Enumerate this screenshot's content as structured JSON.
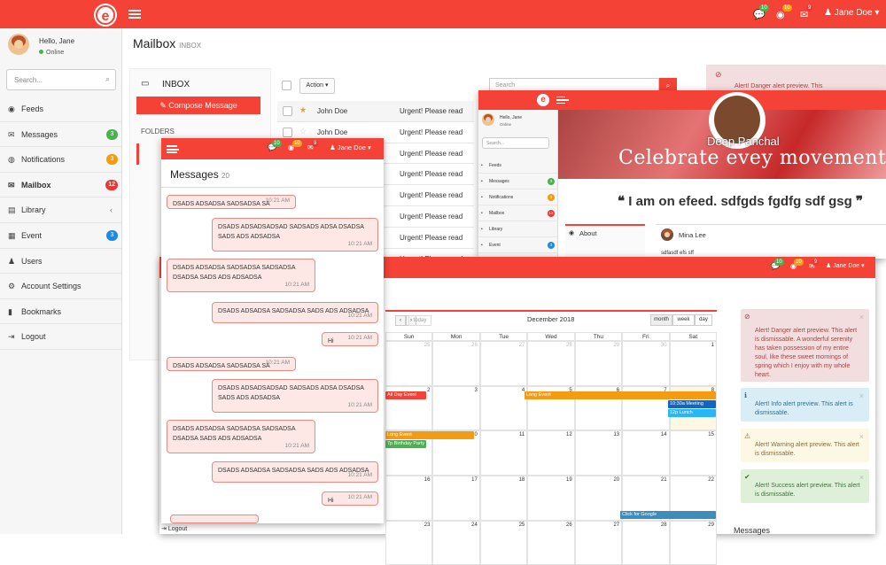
{
  "app": {
    "logo_letter": "e",
    "page_title": "Mailbox",
    "page_subtitle": "INBOX",
    "user_name": "Jane Doe",
    "top_badges": [
      "10",
      "10",
      "9"
    ]
  },
  "sidebar": {
    "greeting": "Hello, Jane",
    "status": "Online",
    "search_placeholder": "Search...",
    "items": [
      {
        "label": "Feeds",
        "icon": "feeds-icon",
        "glyph": "◉",
        "badge": "",
        "badge_color": ""
      },
      {
        "label": "Messages",
        "icon": "messages-icon",
        "glyph": "✉",
        "badge": "3",
        "badge_color": "green"
      },
      {
        "label": "Notifications",
        "icon": "globe-icon",
        "glyph": "◍",
        "badge": "3",
        "badge_color": "orange"
      },
      {
        "label": "Mailbox",
        "icon": "envelope-icon",
        "glyph": "✉",
        "badge": "12",
        "badge_color": "red"
      },
      {
        "label": "Library",
        "icon": "book-icon",
        "glyph": "▤",
        "badge": "",
        "badge_color": ""
      },
      {
        "label": "Event",
        "icon": "calendar-icon",
        "glyph": "▦",
        "badge": "3",
        "badge_color": "blue"
      },
      {
        "label": "Users",
        "icon": "users-icon",
        "glyph": "♟",
        "badge": "",
        "badge_color": ""
      },
      {
        "label": "Account Settings",
        "icon": "gear-icon",
        "glyph": "⚙",
        "badge": "",
        "badge_color": ""
      },
      {
        "label": "Bookmarks",
        "icon": "bookmark-icon",
        "glyph": "▮",
        "badge": "",
        "badge_color": ""
      },
      {
        "label": "Logout",
        "icon": "logout-icon",
        "glyph": "⇥",
        "badge": "",
        "badge_color": ""
      }
    ]
  },
  "mailbox": {
    "inbox_label": "INBOX",
    "compose_label": "Compose Message",
    "folders_label": "FOLDERS",
    "action_label": "Action",
    "search_placeholder": "Search",
    "rows": [
      {
        "from": "John Doe",
        "subject": "Urgent! Please read",
        "starred": true
      },
      {
        "from": "John Doe",
        "subject": "Urgent! Please read",
        "starred": false
      },
      {
        "from": "John Doe",
        "subject": "Urgent! Please read",
        "starred": false
      },
      {
        "from": "John Doe",
        "subject": "Urgent! Please read",
        "starred": false
      },
      {
        "from": "",
        "subject": "Urgent! Please read",
        "starred": false
      },
      {
        "from": "",
        "subject": "Urgent! Please read",
        "starred": false
      },
      {
        "from": "",
        "subject": "Urgent! Please read",
        "starred": false
      },
      {
        "from": "",
        "subject": "Urgent! Please read",
        "starred": false
      }
    ]
  },
  "messages_window": {
    "title": "Messages",
    "count": "20",
    "user": "Jane Doe",
    "badges": [
      "10",
      "10",
      "9"
    ],
    "logout": "Logout",
    "bubbles": [
      {
        "text": "DSADS ADSADSA SADSADSA SA",
        "time": "10:21 AM",
        "side": "left"
      },
      {
        "text": "DSADS ADSADSADSAD SADSADS ADSA DSADSA SADS ADS ADSADSA",
        "time": "10:21 AM",
        "side": "right"
      },
      {
        "text": "DSADS ADSADSA SADSADSA SADSADSA DSADSA SADS ADS ADSADSA",
        "time": "10:21 AM",
        "side": "left"
      },
      {
        "text": "DSADS ADSADSA SADSADSA SADS ADS ADSADSA",
        "time": "10:21 AM",
        "side": "right"
      },
      {
        "text": "Hi",
        "time": "10:21 AM",
        "side": "right"
      },
      {
        "text": "DSADS ADSADSA SADSADSA SA",
        "time": "10:21 AM",
        "side": "left"
      },
      {
        "text": "DSADS ADSADSADSAD SADSADS ADSA DSADSA SADS ADS ADSADSA",
        "time": "10:21 AM",
        "side": "right"
      },
      {
        "text": "DSADS ADSADSA SADSADSA SADSADSA DSADSA SADS ADS ADSADSA",
        "time": "10:21 AM",
        "side": "left"
      },
      {
        "text": "DSADS ADSADSA SADSADSA SADS ADS ADSADSA",
        "time": "10:21 AM",
        "side": "right"
      },
      {
        "text": "Hi",
        "time": "10:21 AM",
        "side": "right"
      }
    ]
  },
  "profile_window": {
    "greeting": "Hello, Jane",
    "status": "Online",
    "search_placeholder": "Search...",
    "name": "Deep Panchal",
    "tagline": "Celebrate evey movement",
    "quote": "I am on efeed. sdfgds fgdfg sdf gsg",
    "about_label": "About",
    "post_author": "Mina Lee",
    "post_text": "sdfasdf efs sff",
    "nav": [
      {
        "label": "Feeds",
        "badge": "",
        "color": ""
      },
      {
        "label": "Messages",
        "badge": "3",
        "color": "green"
      },
      {
        "label": "Notifications",
        "badge": "3",
        "color": "orange"
      },
      {
        "label": "Mailbox",
        "badge": "12",
        "color": "red"
      },
      {
        "label": "Library",
        "badge": "",
        "color": ""
      },
      {
        "label": "Event",
        "badge": "3",
        "color": "blue"
      },
      {
        "label": "Users",
        "badge": "",
        "color": ""
      }
    ]
  },
  "calendar_window": {
    "user": "Jane Doe",
    "badges": [
      "10",
      "10",
      "9"
    ],
    "month_title": "December 2018",
    "today_label": "today",
    "views": [
      "month",
      "week",
      "day"
    ],
    "weekdays": [
      "Sun",
      "Mon",
      "Tue",
      "Wed",
      "Thu",
      "Fri",
      "Sat"
    ],
    "weeks": [
      [
        "25",
        "26",
        "27",
        "28",
        "29",
        "30",
        "1"
      ],
      [
        "2",
        "3",
        "4",
        "5",
        "6",
        "7",
        "8"
      ],
      [
        "9",
        "10",
        "11",
        "12",
        "13",
        "14",
        "15"
      ],
      [
        "16",
        "17",
        "18",
        "19",
        "20",
        "21",
        "22"
      ],
      [
        "23",
        "24",
        "25",
        "26",
        "27",
        "28",
        "29"
      ]
    ],
    "events": {
      "all_day": "All Day Event",
      "long": "Long Event",
      "meeting": "10:30a Meeting",
      "lunch": "12p Lunch",
      "long2": "Long Event",
      "birthday": "7p Birthday Party",
      "google": "Click for Google"
    },
    "messages_label": "Messages"
  },
  "alerts": {
    "top_danger": "Alert! Danger alert preview. This",
    "danger": "Alert! Danger alert preview. This alert is dismissable. A wonderful serenity has taken possession of my entire soul, like these sweet mornings of spring which I enjoy with my whole heart.",
    "info": "Alert! Info alert preview. This alert is dismissable.",
    "warning": "Alert! Warning alert preview. This alert is dismissable.",
    "success": "Alert! Success alert preview. This alert is dismissable."
  },
  "colors": {
    "brand": "#f44336",
    "green": "#4caf50",
    "orange": "#f39c12",
    "red": "#e53935",
    "blue": "#1e88e5"
  }
}
